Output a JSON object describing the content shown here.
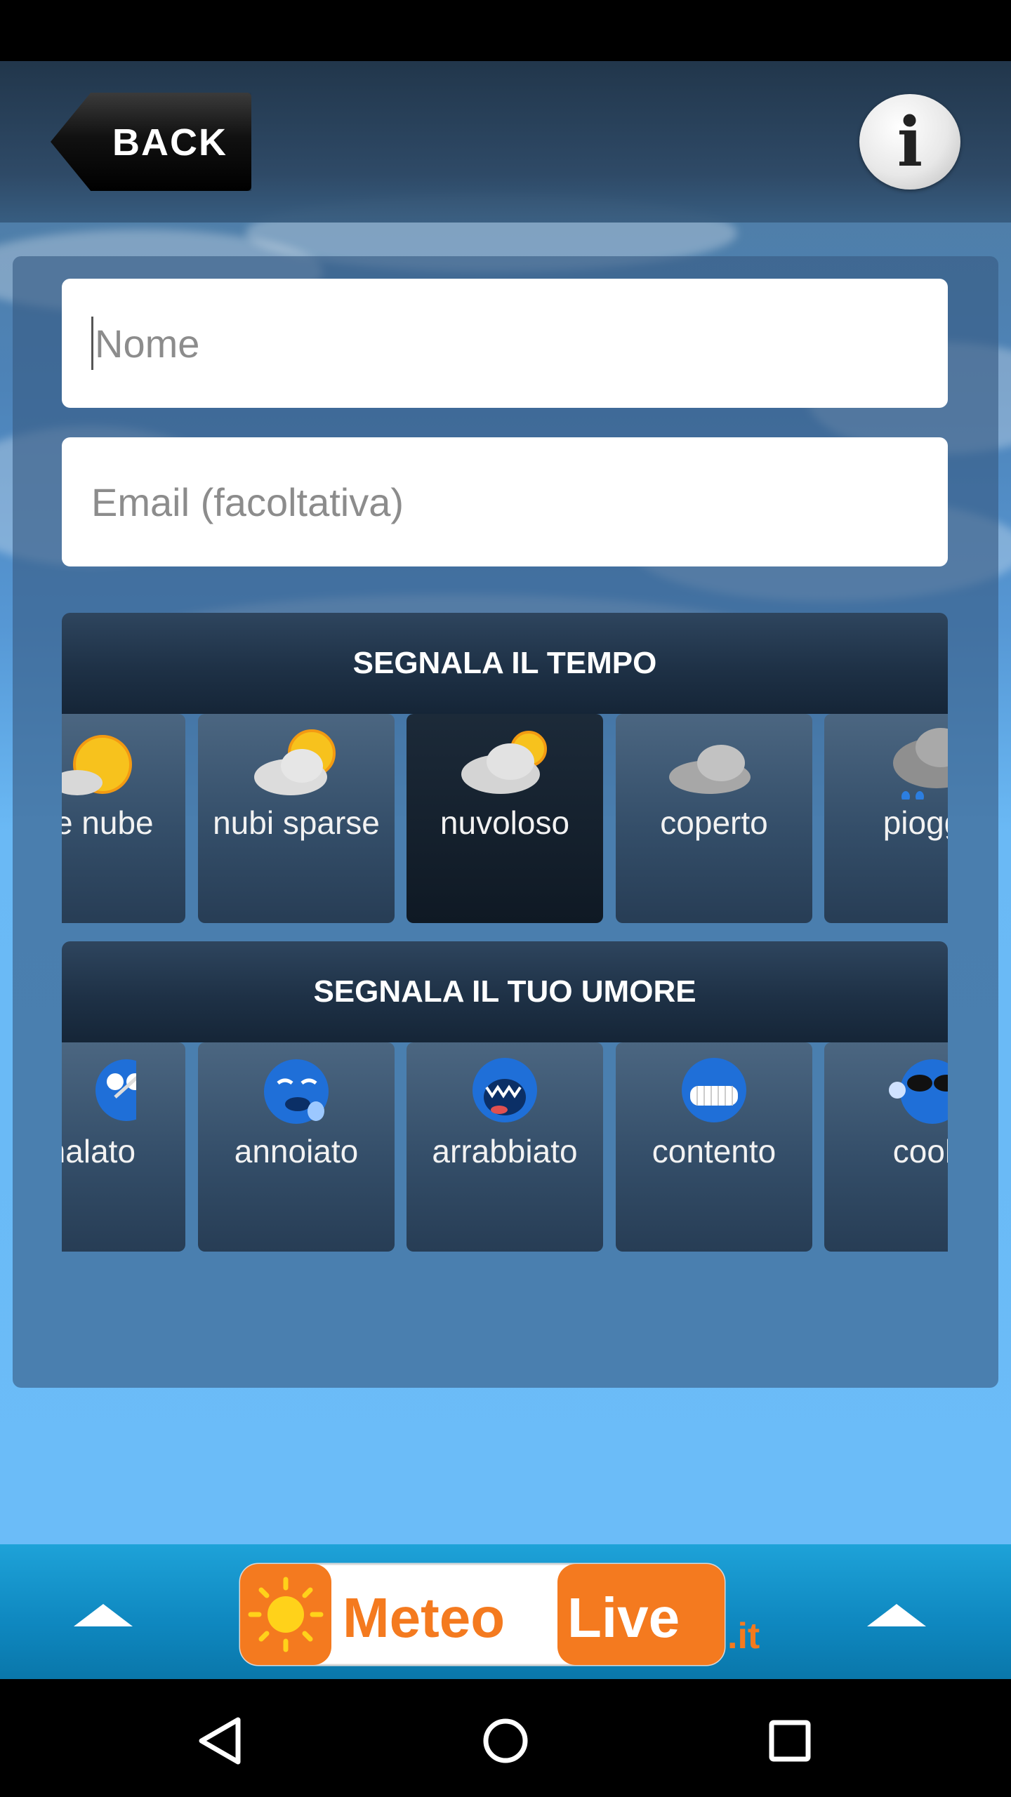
{
  "header": {
    "back_label": "BACK",
    "info_icon": "info-icon",
    "info_glyph": "i"
  },
  "form": {
    "name_placeholder": "Nome",
    "email_placeholder": "Email (facoltativa)"
  },
  "weather_section": {
    "title": "SEGNALA IL TEMPO",
    "items": [
      {
        "label": "che nube",
        "icon": "sun-cloud-icon",
        "selected": false
      },
      {
        "label": "nubi sparse",
        "icon": "partly-cloudy-icon",
        "selected": false
      },
      {
        "label": "nuvoloso",
        "icon": "cloudy-icon",
        "selected": true
      },
      {
        "label": "coperto",
        "icon": "overcast-icon",
        "selected": false
      },
      {
        "label": "piogg",
        "icon": "rain-icon",
        "selected": false
      }
    ]
  },
  "mood_section": {
    "title": "SEGNALA IL TUO UMORE",
    "items": [
      {
        "label": "malato",
        "icon": "sick-face-icon"
      },
      {
        "label": "annoiato",
        "icon": "bored-face-icon"
      },
      {
        "label": "arrabbiato",
        "icon": "angry-face-icon"
      },
      {
        "label": "contento",
        "icon": "happy-face-icon"
      },
      {
        "label": "cool",
        "icon": "cool-face-icon"
      }
    ]
  },
  "footer": {
    "logo_text_1": "Meteo",
    "logo_text_2": "Live",
    "logo_suffix": ".it"
  },
  "colors": {
    "sky": "#6bb8f5",
    "footer": "#0e87bf",
    "logo_orange": "#f47a1f"
  }
}
